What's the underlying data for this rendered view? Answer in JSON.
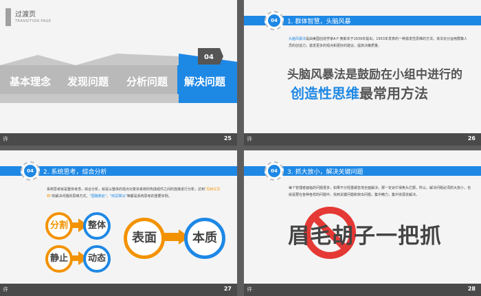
{
  "slides": {
    "s25": {
      "transition_title": "过渡页",
      "transition_sub": "TRANSITION PAGE",
      "labels": [
        "基本理念",
        "发现问题",
        "分析问题",
        "解决问题"
      ],
      "badge": "04",
      "footer_left": "许",
      "page": "25"
    },
    "s26": {
      "badge": "04",
      "header": "1. 群体智慧，头脑风暴",
      "intro_hl": "头脑风暴法",
      "intro_rest": "是由美国创造学家A·F·奥斯本于1939年提出，1953年发表的一种激发性思维的方法。该法充分运用群策人员的创造力，激发更多的观点和更好的建议，提高决策质量。",
      "big_line1": "头脑风暴法是鼓励在小组中进行的",
      "big_line2_blue": "创造性思维",
      "big_line2_dark": "最常用方法",
      "footer_left": "许",
      "page": "26"
    },
    "s27": {
      "badge": "04",
      "header": "2. 系统思考，综合分析",
      "intro_a": "系统思考就是整体考虑，综合分析，就是以整体的观点对复杂系统的构成组件之间的连接进行分析，达到",
      "intro_o1": "\"见树又见林\"",
      "intro_b": "的解决问题的思维方式。",
      "intro_h1": "\"围魏救赵\"",
      "intro_c": "、",
      "intro_h2": "\"田忌赛马\"",
      "intro_d": "等都是系统思考的重要实例。",
      "pairs": [
        [
          "分割",
          "整体"
        ],
        [
          "静止",
          "动态"
        ]
      ],
      "big_pair": [
        "表面",
        "本质"
      ],
      "footer_left": "许",
      "page": "27"
    },
    "s28": {
      "badge": "04",
      "header": "3. 抓大放小，解决关键问题",
      "intro": "每个管理者面临的问题很多，如果不分轻重缓急地全面解决，那一定会忙得焦头烂额，所以，解决问题必须抓大放小，也就是要在各种各样的问题中，找到关键问题和突出问题，集中精力，集中资源去解决。",
      "big_text": "眉毛胡子一把抓",
      "footer_left": "许",
      "page": "28"
    }
  },
  "colors": {
    "blue": "#1e88e5",
    "orange": "#f39200",
    "grey": "#5d5d5d"
  }
}
